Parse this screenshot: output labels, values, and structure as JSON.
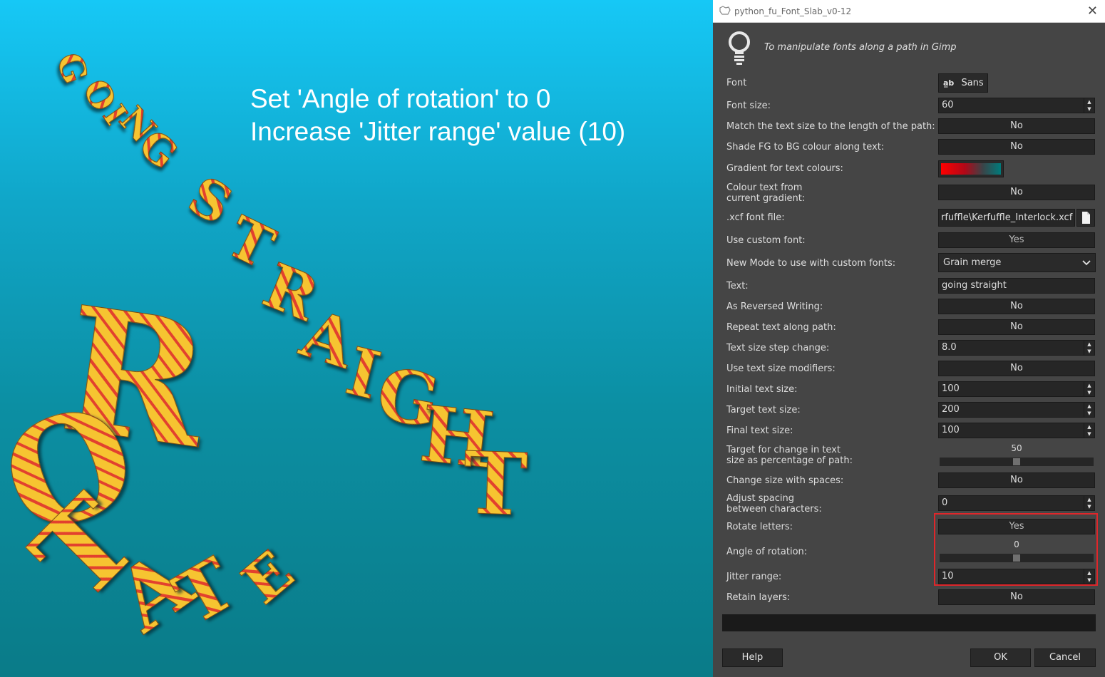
{
  "canvas": {
    "instruction_line1": "Set 'Angle of rotation' to 0",
    "instruction_line2": "Increase 'Jitter range' value (10)",
    "artwork_letters": [
      "G",
      "O",
      "I",
      "N",
      "G",
      "S",
      "T",
      "R",
      "A",
      "I",
      "G",
      "H",
      "T",
      "R",
      "O",
      "T",
      "A",
      "T",
      "E"
    ]
  },
  "dialog": {
    "title": "python_fu_Font_Slab_v0-12",
    "description": "To manipulate fonts along a path in Gimp",
    "font_label": "Font",
    "font_value": "Sans",
    "font_size_label": "Font size:",
    "font_size_value": "60",
    "match_label": "Match the text size to the length of the path:",
    "match_value": "No",
    "shade_label": "Shade FG to BG colour along text:",
    "shade_value": "No",
    "gradient_label": "Gradient for text colours:",
    "colour_from_gradient_label_1": "Colour text from",
    "colour_from_gradient_label_2": "current gradient:",
    "colour_from_gradient_value": "No",
    "xcf_label": ".xcf font file:",
    "xcf_value": "rfuffle\\Kerfuffle_Interlock.xcf",
    "custom_font_label": "Use custom font:",
    "custom_font_value": "Yes",
    "mode_label": "New Mode to use with custom fonts:",
    "mode_value": "Grain merge",
    "text_label": "Text:",
    "text_value": "going straight",
    "reversed_label": "As Reversed Writing:",
    "reversed_value": "No",
    "repeat_label": "Repeat text along path:",
    "repeat_value": "No",
    "step_label": "Text size step change:",
    "step_value": "8.0",
    "modifiers_label": "Use text size modifiers:",
    "modifiers_value": "No",
    "initial_label": "Initial text size:",
    "initial_value": "100",
    "target_label": "Target text size:",
    "target_value": "200",
    "final_label": "Final text size:",
    "final_value": "100",
    "target_pct_label_1": "Target for change in text",
    "target_pct_label_2": "size as percentage of path:",
    "target_pct_value": "50",
    "spaces_label": "Change size with spaces:",
    "spaces_value": "No",
    "spacing_label_1": "Adjust spacing",
    "spacing_label_2": "between characters:",
    "spacing_value": "0",
    "rotate_label": "Rotate letters:",
    "rotate_value": "Yes",
    "angle_label": "Angle of rotation:",
    "angle_value": "0",
    "jitter_label": "Jitter range:",
    "jitter_value": "10",
    "retain_label": "Retain layers:",
    "retain_value": "No",
    "help_label": "Help",
    "ok_label": "OK",
    "cancel_label": "Cancel"
  },
  "colors": {
    "dialog_bg": "#454545",
    "field_bg": "#262626",
    "highlight_box": "#e0262a",
    "gradient_start": "#ff0000",
    "gradient_end": "#007b7b"
  }
}
